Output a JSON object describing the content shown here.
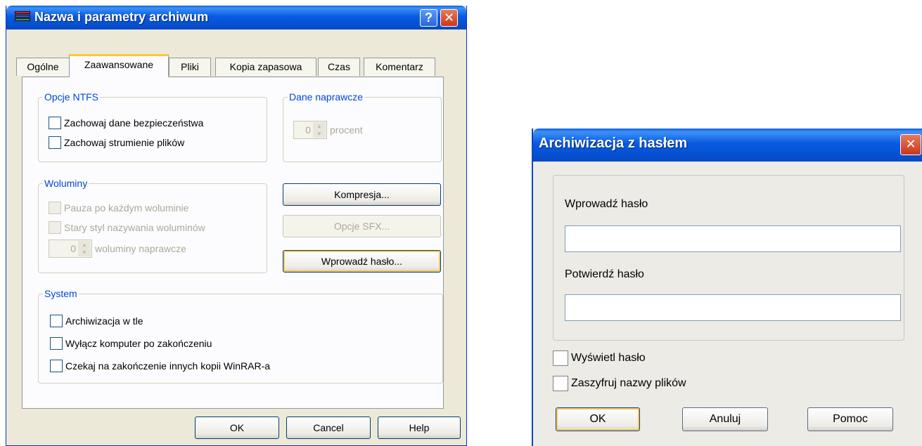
{
  "main_dialog": {
    "title": "Nazwa i parametry archiwum",
    "help_glyph": "?",
    "close_glyph": "✕",
    "tabs": [
      {
        "label": "Ogólne"
      },
      {
        "label": "Zaawansowane"
      },
      {
        "label": "Pliki"
      },
      {
        "label": "Kopia zapasowa"
      },
      {
        "label": "Czas"
      },
      {
        "label": "Komentarz"
      }
    ],
    "ntfs": {
      "legend": "Opcje NTFS",
      "options": [
        "Zachowaj dane bezpieczeństwa",
        "Zachowaj strumienie plików"
      ]
    },
    "recovery": {
      "legend": "Dane naprawcze",
      "value": "0",
      "unit": "procent"
    },
    "volumes": {
      "legend": "Woluminy",
      "options": [
        "Pauza po każdym woluminie",
        "Stary styl nazywania woluminów"
      ],
      "recovery_value": "0",
      "recovery_label": "woluminy naprawcze"
    },
    "buttons": {
      "compression": "Kompresja...",
      "sfx": "Opcje SFX...",
      "password": "Wprowadź hasło...",
      "ok": "OK",
      "cancel": "Cancel",
      "help": "Help"
    },
    "system": {
      "legend": "System",
      "options": [
        "Archiwizacja w tle",
        "Wyłącz komputer po zakończeniu",
        "Czekaj na zakończenie innych kopii WinRAR-a"
      ]
    }
  },
  "password_dialog": {
    "title": "Archiwizacja z hasłem",
    "close_glyph": "✕",
    "enter_label": "Wprowadź hasło",
    "confirm_label": "Potwierdź hasło",
    "enter_value": "",
    "confirm_value": "",
    "show_password": "Wyświetl hasło",
    "encrypt_names": "Zaszyfruj nazwy plików",
    "buttons": {
      "ok": "OK",
      "cancel": "Anuluj",
      "help": "Pomoc"
    }
  }
}
